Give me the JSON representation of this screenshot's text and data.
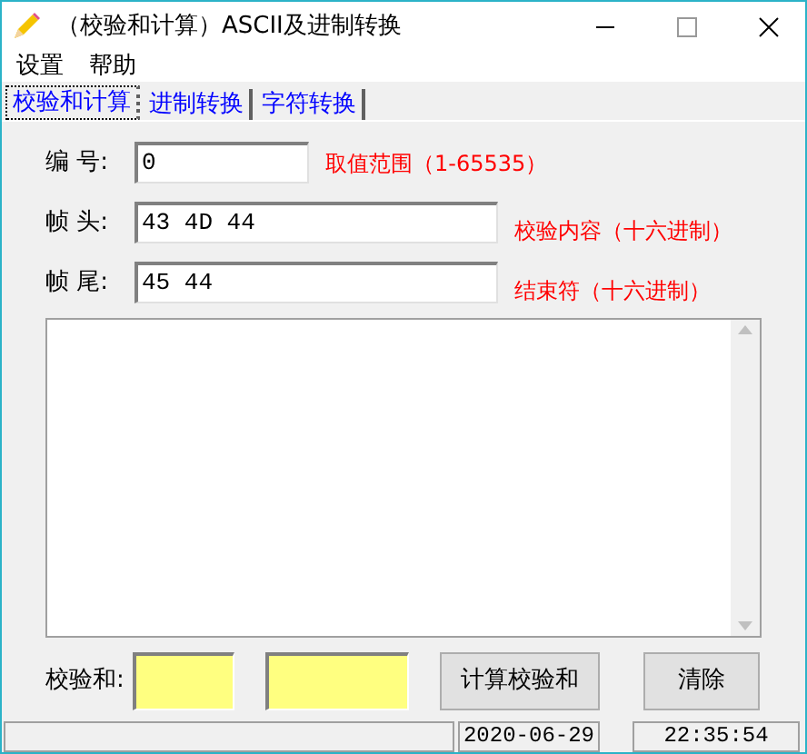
{
  "window": {
    "title": "（校验和计算）ASCII及进制转换"
  },
  "menu": [
    "设置",
    "帮助"
  ],
  "tabs": [
    {
      "label": "校验和计算",
      "selected": true
    },
    {
      "label": "进制转换",
      "selected": false
    },
    {
      "label": "字符转换",
      "selected": false
    }
  ],
  "fields": [
    {
      "label": "编 号:",
      "value": "0",
      "hint": "取值范围（1-65535）",
      "wide": false
    },
    {
      "label": "帧 头:",
      "value": "43 4D 44",
      "hint": "校验内容（十六进制）",
      "wide": true
    },
    {
      "label": "帧 尾:",
      "value": "45 44",
      "hint": "结束符（十六进制）",
      "wide": true
    }
  ],
  "checksum": {
    "label": "校验和:"
  },
  "buttons": [
    "计算校验和",
    "清除"
  ],
  "status_bar": [
    "2020-06-29",
    "22:35:54"
  ]
}
